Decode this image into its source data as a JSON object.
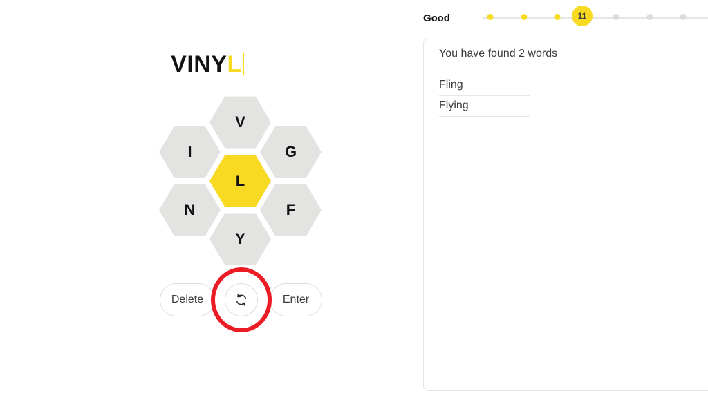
{
  "puzzle": {
    "input": {
      "outer_letters_typed": "VINY",
      "center_letter_typed": "L"
    },
    "hive": {
      "center": {
        "letter": "L",
        "color": "#f7da21"
      },
      "outer_color": "#e3e3e1",
      "cells": [
        {
          "position": "top",
          "letter": "V"
        },
        {
          "position": "upper-left",
          "letter": "I"
        },
        {
          "position": "upper-right",
          "letter": "G"
        },
        {
          "position": "lower-left",
          "letter": "N"
        },
        {
          "position": "lower-right",
          "letter": "F"
        },
        {
          "position": "bottom",
          "letter": "Y"
        }
      ]
    },
    "controls": {
      "delete_label": "Delete",
      "shuffle_icon": "shuffle-refresh-icon",
      "enter_label": "Enter"
    },
    "annotation": {
      "type": "highlight-circle",
      "color": "#ec1c24",
      "target": "shuffle-button"
    }
  },
  "rank": {
    "label": "Good",
    "current_score": "11",
    "current_index": 3,
    "dots": [
      {
        "state": "done"
      },
      {
        "state": "done"
      },
      {
        "state": "done"
      },
      {
        "state": "current"
      },
      {
        "state": "todo"
      },
      {
        "state": "todo"
      },
      {
        "state": "todo"
      }
    ]
  },
  "words": {
    "found_summary": "You have found 2 words",
    "items": [
      {
        "word": "Fling"
      },
      {
        "word": "Flying"
      }
    ]
  }
}
